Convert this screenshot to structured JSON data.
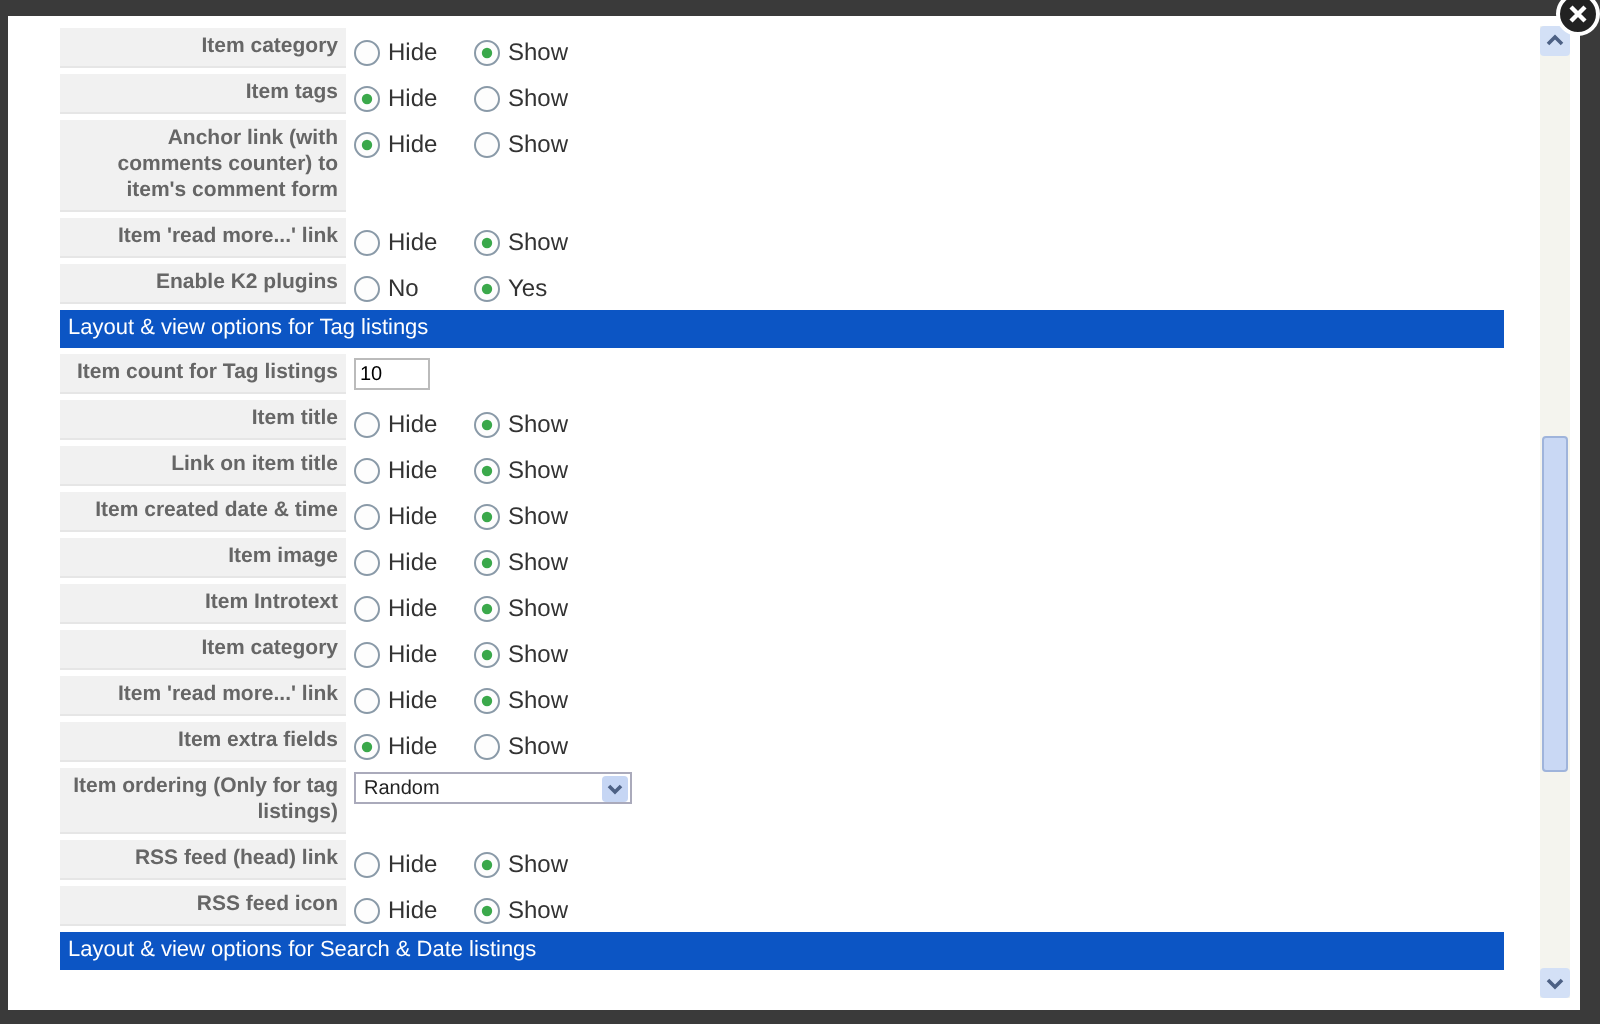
{
  "rows": [
    {
      "kind": "radio",
      "label": "Item category",
      "options": [
        {
          "label": "Hide",
          "selected": false
        },
        {
          "label": "Show",
          "selected": true
        }
      ]
    },
    {
      "kind": "radio",
      "label": "Item tags",
      "options": [
        {
          "label": "Hide",
          "selected": true
        },
        {
          "label": "Show",
          "selected": false
        }
      ]
    },
    {
      "kind": "radio",
      "label": "Anchor link (with comments counter) to item's comment form",
      "options": [
        {
          "label": "Hide",
          "selected": true
        },
        {
          "label": "Show",
          "selected": false
        }
      ]
    },
    {
      "kind": "radio",
      "label": "Item 'read more...' link",
      "options": [
        {
          "label": "Hide",
          "selected": false
        },
        {
          "label": "Show",
          "selected": true
        }
      ]
    },
    {
      "kind": "radio",
      "label": "Enable K2 plugins",
      "options": [
        {
          "label": "No",
          "selected": false
        },
        {
          "label": "Yes",
          "selected": true
        }
      ]
    },
    {
      "kind": "header",
      "label": "Layout & view options for Tag listings"
    },
    {
      "kind": "text",
      "label": "Item count for Tag listings",
      "value": "10"
    },
    {
      "kind": "radio",
      "label": "Item title",
      "options": [
        {
          "label": "Hide",
          "selected": false
        },
        {
          "label": "Show",
          "selected": true
        }
      ]
    },
    {
      "kind": "radio",
      "label": "Link on item title",
      "options": [
        {
          "label": "Hide",
          "selected": false
        },
        {
          "label": "Show",
          "selected": true
        }
      ]
    },
    {
      "kind": "radio",
      "label": "Item created date & time",
      "options": [
        {
          "label": "Hide",
          "selected": false
        },
        {
          "label": "Show",
          "selected": true
        }
      ]
    },
    {
      "kind": "radio",
      "label": "Item image",
      "options": [
        {
          "label": "Hide",
          "selected": false
        },
        {
          "label": "Show",
          "selected": true
        }
      ]
    },
    {
      "kind": "radio",
      "label": "Item Introtext",
      "options": [
        {
          "label": "Hide",
          "selected": false
        },
        {
          "label": "Show",
          "selected": true
        }
      ]
    },
    {
      "kind": "radio",
      "label": "Item category",
      "options": [
        {
          "label": "Hide",
          "selected": false
        },
        {
          "label": "Show",
          "selected": true
        }
      ]
    },
    {
      "kind": "radio",
      "label": "Item 'read more...' link",
      "options": [
        {
          "label": "Hide",
          "selected": false
        },
        {
          "label": "Show",
          "selected": true
        }
      ]
    },
    {
      "kind": "radio",
      "label": "Item extra fields",
      "options": [
        {
          "label": "Hide",
          "selected": true
        },
        {
          "label": "Show",
          "selected": false
        }
      ]
    },
    {
      "kind": "select",
      "label": "Item ordering (Only for tag listings)",
      "value": "Random"
    },
    {
      "kind": "radio",
      "label": "RSS feed (head) link",
      "options": [
        {
          "label": "Hide",
          "selected": false
        },
        {
          "label": "Show",
          "selected": true
        }
      ]
    },
    {
      "kind": "radio",
      "label": "RSS feed icon",
      "options": [
        {
          "label": "Hide",
          "selected": false
        },
        {
          "label": "Show",
          "selected": true
        }
      ]
    },
    {
      "kind": "header",
      "label": "Layout & view options for Search & Date listings"
    }
  ]
}
